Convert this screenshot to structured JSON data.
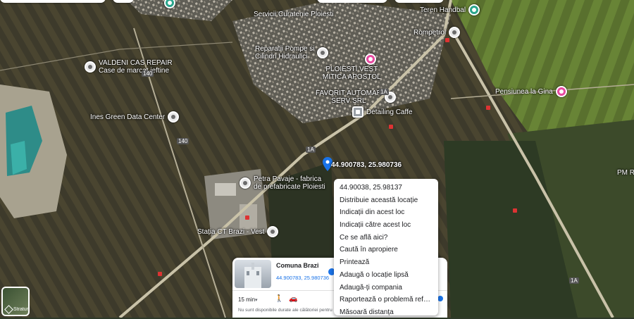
{
  "map": {
    "pois": [
      {
        "id": "servicii",
        "label": "Servicii Curatenie Ploiesti",
        "style": "gray"
      },
      {
        "id": "teren",
        "label": "Teren Handbal",
        "style": "teal"
      },
      {
        "id": "rompetrol",
        "label": "Rompetrol",
        "style": "gray"
      },
      {
        "id": "valdeni",
        "line1": "VALDENI CAS REPAIR",
        "line2": "Case de marcat ieftine",
        "style": "gray"
      },
      {
        "id": "reparatii",
        "line1": "Reparatii Pompe si",
        "line2": "Cilindri Hidraulici",
        "style": "gray"
      },
      {
        "id": "ploiesti-vest",
        "line1": "PLOIESTI VEST",
        "line2": "MITICA APOSTOL",
        "style": "pink"
      },
      {
        "id": "favorit",
        "line1": "FAVORIT AUTOMAR",
        "line2": "SERV SRL",
        "style": "gray"
      },
      {
        "id": "detailing",
        "label": "Detailing Caffe",
        "style": "gray2"
      },
      {
        "id": "pensiunea",
        "label": "Pensiunea la Gina",
        "style": "pink"
      },
      {
        "id": "ines",
        "label": "Ines Green Data Center",
        "style": "gray"
      },
      {
        "id": "petra",
        "line1": "Petra Pavaje - fabrica",
        "line2": "de prefabricate Ploiesti",
        "style": "gray"
      },
      {
        "id": "statia",
        "label": "Stația CT Brazi - Vest",
        "style": "gray"
      },
      {
        "id": "pm",
        "label": "PM Ra",
        "style": "none"
      }
    ],
    "road_badges": [
      "140",
      "140",
      "1A",
      "1A",
      "1A",
      "1A",
      "1A",
      "1A",
      "1A",
      "1A",
      "1A"
    ],
    "dropped_pin_label": "44.900783, 25.980736",
    "layers_label": "Straturi"
  },
  "context_menu": {
    "items": [
      "44.90038, 25.98137",
      "Distribuie această locație",
      "Indicații din acest loc",
      "Indicații către acest loc",
      "Ce se află aici?",
      "Caută în apropiere",
      "Printează",
      "Adaugă o locație lipsă",
      "Adaugă-ți compania",
      "Raportează o problemă referito...",
      "Măsoară distanța"
    ]
  },
  "place_card": {
    "title": "Comuna Brazi",
    "coords": "44.900783, 25.980736",
    "duration": "15 min",
    "note": "Nu sunt disponibile durate ale călătoriei pentru"
  },
  "colors": {
    "accent": "#1a73e8",
    "poi_pink": "#e64aa0",
    "poi_teal": "#2aa58c"
  }
}
